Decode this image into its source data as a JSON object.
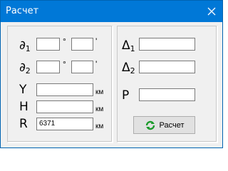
{
  "window": {
    "title": "Расчет",
    "close_glyph": "✕"
  },
  "left": {
    "phi1": {
      "label_main": "∂",
      "label_sub": "1",
      "deg_value": "",
      "deg_symbol": "°",
      "min_value": "",
      "min_symbol": "'"
    },
    "phi2": {
      "label_main": "∂",
      "label_sub": "2",
      "deg_value": "",
      "deg_symbol": "°",
      "min_value": "",
      "min_symbol": "'"
    },
    "y": {
      "label": "Y",
      "value": "",
      "unit": "км"
    },
    "h": {
      "label": "H",
      "value": "",
      "unit": "км"
    },
    "r": {
      "label": "R",
      "value": "6371",
      "unit": "км"
    }
  },
  "right": {
    "delta1": {
      "label_main": "Δ",
      "label_sub": "1",
      "value": ""
    },
    "delta2": {
      "label_main": "Δ",
      "label_sub": "2",
      "value": ""
    },
    "p": {
      "label": "P",
      "value": ""
    }
  },
  "button": {
    "label": "Расчет",
    "icon": "refresh-icon",
    "icon_color": "#1a9a2a"
  },
  "colors": {
    "titlebar": "#0078d7",
    "client": "#f0f0f0"
  }
}
